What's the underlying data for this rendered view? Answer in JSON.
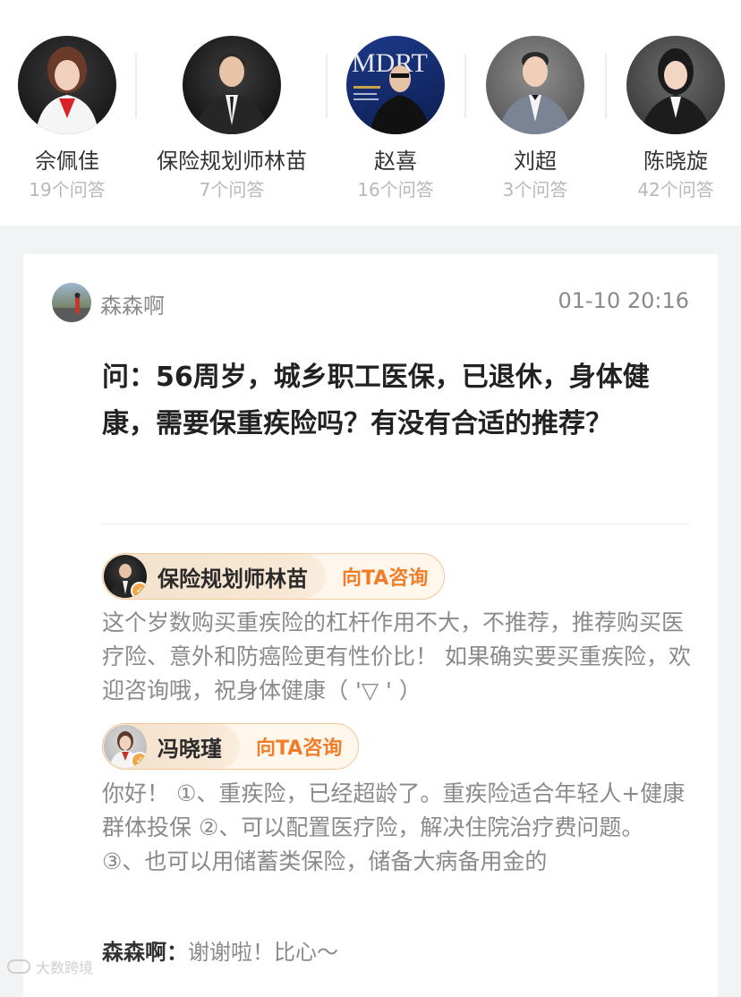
{
  "experts": [
    {
      "name": "佘佩佳",
      "count": "19个问答"
    },
    {
      "name": "保险规划师林苗",
      "count": "7个问答"
    },
    {
      "name": "赵喜",
      "count": "16个问答"
    },
    {
      "name": "刘超",
      "count": "3个问答"
    },
    {
      "name": "陈晓旋",
      "count": "42个问答"
    }
  ],
  "post": {
    "asker": "森森啊",
    "time": "01-10 20:16",
    "question": "问：56周岁，城乡职工医保，已退休，身体健康，需要保重疾险吗？有没有合适的推荐？"
  },
  "answers": [
    {
      "expert": "保险规划师林苗",
      "consult_label": "向TA咨询",
      "text": "这个岁数购买重疾险的杠杆作用不大，不推荐，推荐购买医疗险、意外和防癌险更有性价比！ 如果确实要买重疾险，欢迎咨询哦，祝身体健康（ '▽ ' ）"
    },
    {
      "expert": "冯晓瑾",
      "consult_label": "向TA咨询",
      "text": "你好！ ①、重疾险，已经超龄了。重疾险适合年轻人+健康群体投保 ②、可以配置医疗险，解决住院治疗费问题。 ③、也可以用储蓄类保险，储备大病备用金的"
    }
  ],
  "reply": {
    "name": "森森啊：",
    "text": "谢谢啦！比心～"
  },
  "watermark": "大数跨境",
  "colors": {
    "accent": "#f07d2a",
    "tag_border": "#f1c89a",
    "muted_text": "#8a8a8a"
  }
}
